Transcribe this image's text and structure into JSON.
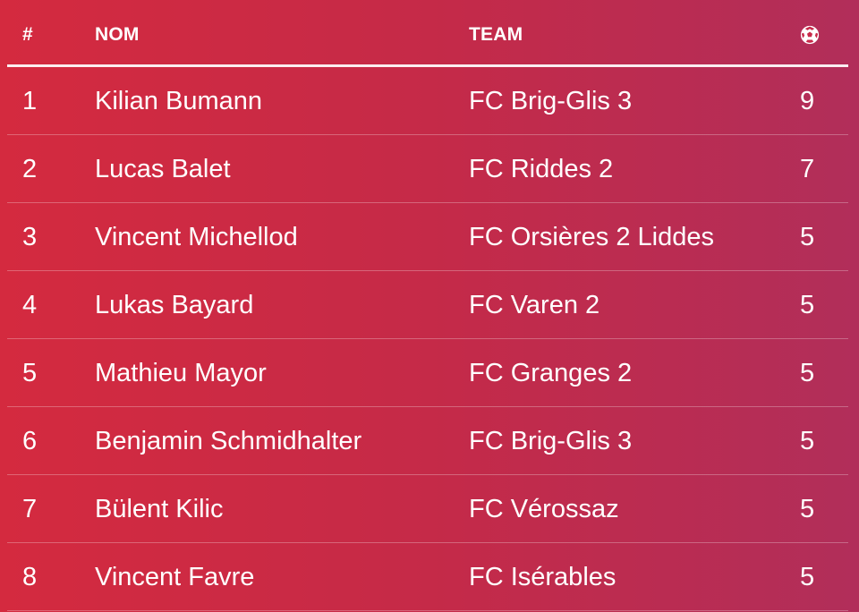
{
  "header": {
    "rank": "#",
    "name": "NOM",
    "team": "TEAM",
    "goals_icon": "soccer-ball-icon"
  },
  "rows": [
    {
      "rank": "1",
      "name": "Kilian Bumann",
      "team": "FC Brig-Glis 3",
      "goals": "9"
    },
    {
      "rank": "2",
      "name": "Lucas Balet",
      "team": "FC Riddes 2",
      "goals": "7"
    },
    {
      "rank": "3",
      "name": "Vincent Michellod",
      "team": "FC Orsières 2 Liddes",
      "goals": "5"
    },
    {
      "rank": "4",
      "name": "Lukas Bayard",
      "team": "FC Varen 2",
      "goals": "5"
    },
    {
      "rank": "5",
      "name": "Mathieu Mayor",
      "team": "FC Granges 2",
      "goals": "5"
    },
    {
      "rank": "6",
      "name": "Benjamin Schmidhalter",
      "team": "FC Brig-Glis 3",
      "goals": "5"
    },
    {
      "rank": "7",
      "name": "Bülent Kilic",
      "team": "FC Vérossaz",
      "goals": "5"
    },
    {
      "rank": "8",
      "name": "Vincent Favre",
      "team": "FC Isérables",
      "goals": "5"
    }
  ],
  "colors": {
    "gradient_start": "#d42a3f",
    "gradient_end": "#b12e5a",
    "text": "#ffffff"
  }
}
